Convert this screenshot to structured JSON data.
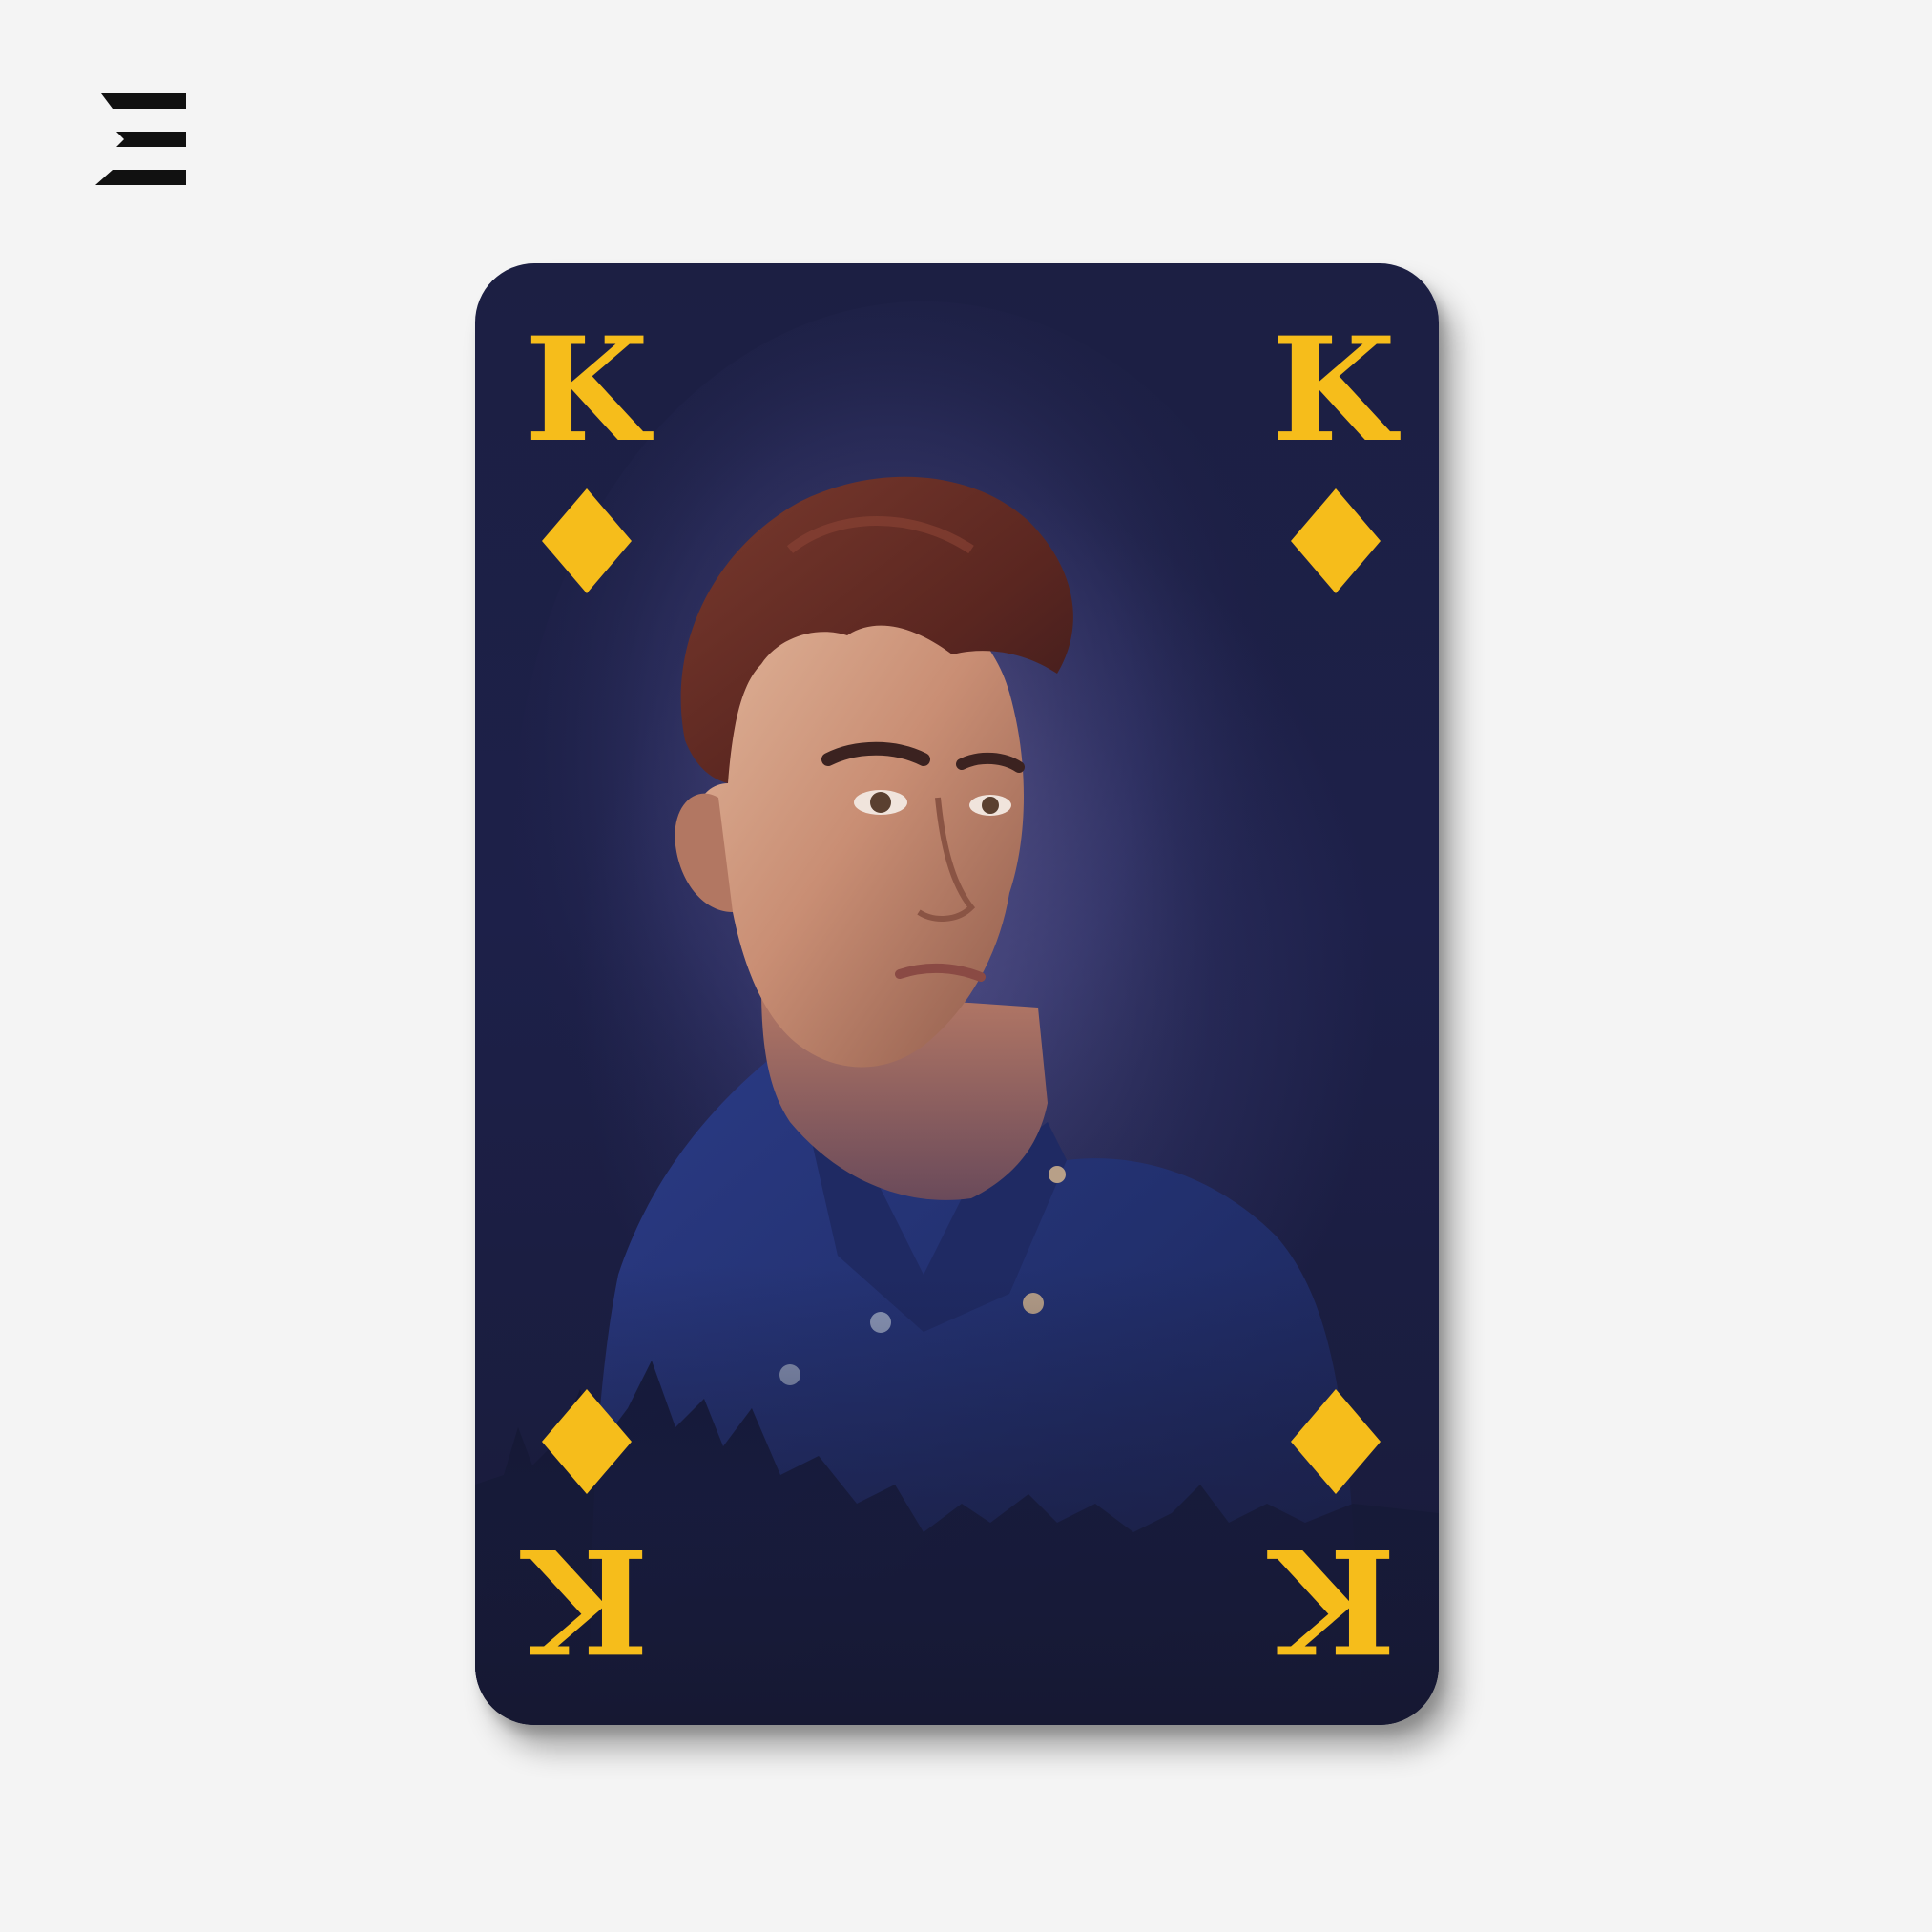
{
  "brand": {
    "logo_icon": "three-bars-logo-icon",
    "color": "#111111"
  },
  "card": {
    "rank": "K",
    "suit": "diamond",
    "suit_color": "#f6bd1b",
    "background_color": "#1c1f43",
    "image": "portrait-photo"
  }
}
